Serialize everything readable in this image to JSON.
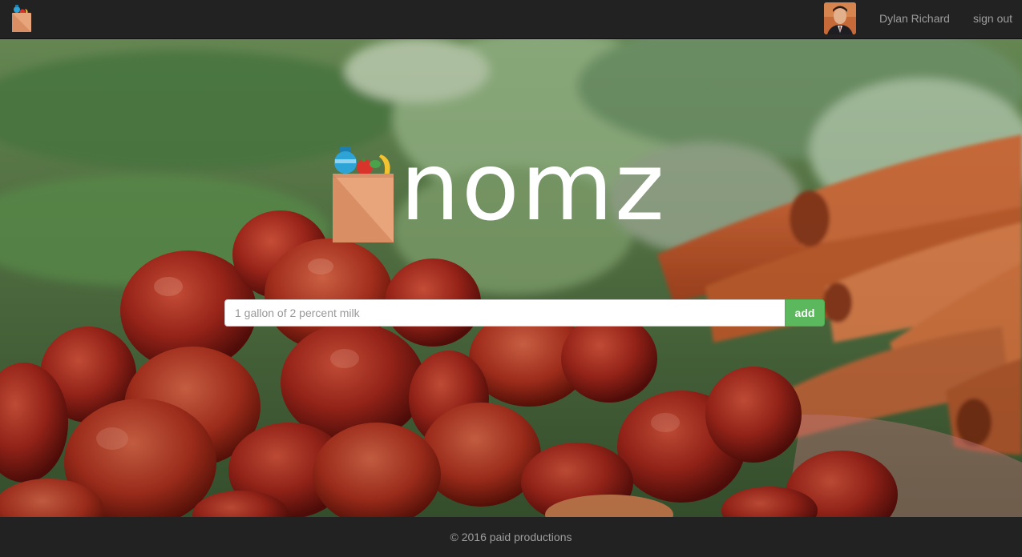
{
  "navbar": {
    "logo_icon": "grocery-bag-icon",
    "user_name": "Dylan Richard",
    "sign_out_label": "sign out"
  },
  "hero": {
    "brand_name": "nomz",
    "brand_icon": "grocery-bag-icon"
  },
  "search": {
    "placeholder": "1 gallon of 2 percent milk",
    "value": "",
    "add_label": "add"
  },
  "footer": {
    "text": "© 2016 paid productions"
  },
  "colors": {
    "navbar_bg": "#222222",
    "add_button": "#5cb85c",
    "bag": "#e8a57c",
    "muted_text": "#9d9d9d"
  }
}
